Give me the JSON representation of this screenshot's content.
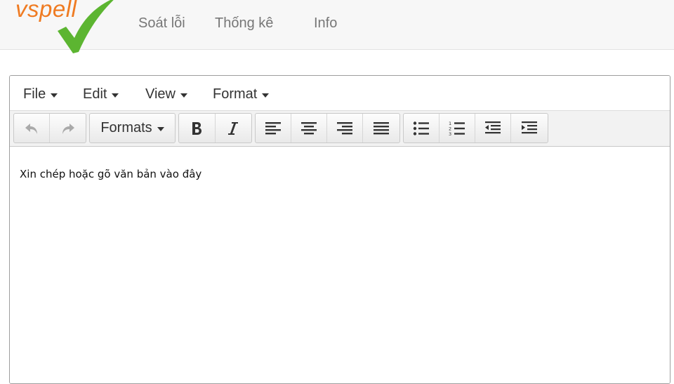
{
  "brand": {
    "name": "vspell",
    "color": "#ef7b22",
    "check_color": "#5cb531"
  },
  "nav": {
    "items": [
      "Soát lỗi",
      "Thống kê",
      "Info"
    ]
  },
  "editor": {
    "menu": [
      "File",
      "Edit",
      "View",
      "Format"
    ],
    "toolbar": {
      "undo_icon": "undo-icon",
      "redo_icon": "redo-icon",
      "formats_label": "Formats",
      "bold_icon": "bold-icon",
      "italic_icon": "italic-icon",
      "align_icons": [
        "align-left-icon",
        "align-center-icon",
        "align-right-icon",
        "align-justify-icon"
      ],
      "list_icons": [
        "bullet-list-icon",
        "numbered-list-icon",
        "outdent-icon",
        "indent-icon"
      ]
    },
    "placeholder": "Xin chép hoặc gõ văn bản vào đây"
  }
}
